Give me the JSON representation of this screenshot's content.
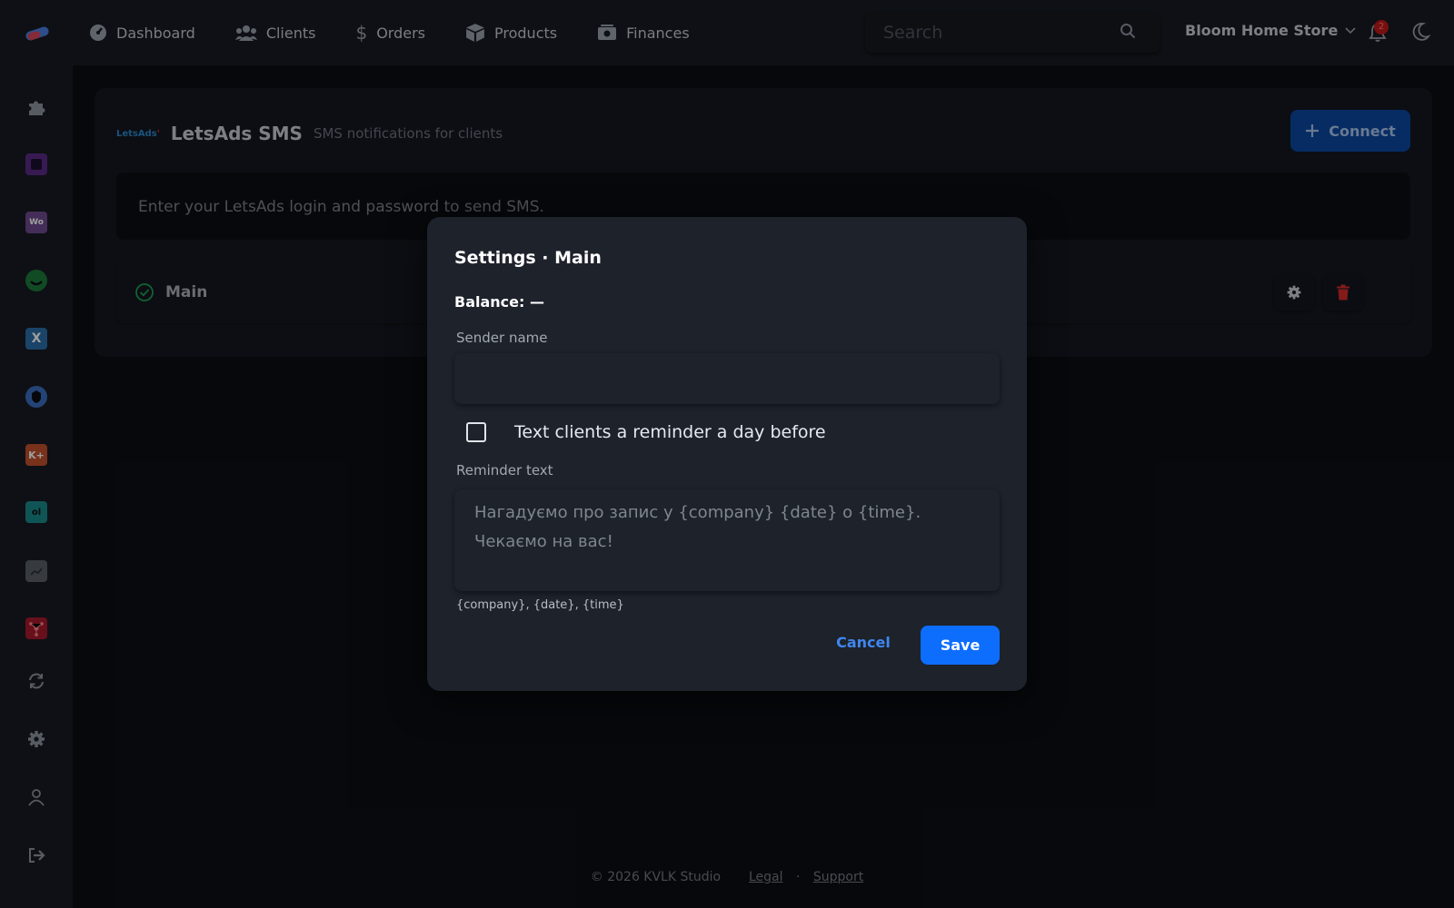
{
  "topbar": {
    "nav": [
      {
        "label": "Dashboard",
        "icon": "dashboard-icon"
      },
      {
        "label": "Clients",
        "icon": "users-icon"
      },
      {
        "label": "Orders",
        "icon": "dollar-icon"
      },
      {
        "label": "Products",
        "icon": "box-icon"
      },
      {
        "label": "Finances",
        "icon": "money-icon"
      }
    ],
    "search_placeholder": "Search",
    "store_name": "Bloom Home Store",
    "notification_count": "2"
  },
  "sidebar": {
    "items": [
      {
        "icon": "puzzle-icon"
      },
      {
        "icon": "square-app-icon",
        "color": "#5b2a86"
      },
      {
        "icon": "woo-icon",
        "label": "Wo",
        "color": "#6f4a8f"
      },
      {
        "icon": "green-smile-icon",
        "color": "#1c7a3a"
      },
      {
        "icon": "x-app-icon",
        "label": "X",
        "color": "#2a6ea8"
      },
      {
        "icon": "shield-app-icon",
        "color": "#3a6fbf"
      },
      {
        "icon": "k-app-icon",
        "label": "K+",
        "color": "#c2502a"
      },
      {
        "icon": "ol-app-icon",
        "label": "ol",
        "color": "#1b8a8a"
      },
      {
        "icon": "chart-app-icon",
        "color": "#5a6066"
      },
      {
        "icon": "network-app-icon",
        "color": "#a8192e"
      },
      {
        "icon": "sync-icon"
      },
      {
        "icon": "gear-icon"
      },
      {
        "icon": "user-icon"
      },
      {
        "icon": "logout-icon"
      }
    ]
  },
  "card": {
    "logo_text_a": "LetsAds",
    "title": "LetsAds SMS",
    "subtitle": "SMS notifications for clients",
    "connect_label": "Connect",
    "info": "Enter your LetsAds login and password to send SMS.",
    "account_name": "Main"
  },
  "modal": {
    "title": "Settings · Main",
    "balance": "Balance: —",
    "sender_label": "Sender name",
    "sender_value": "",
    "reminder_checkbox_label": "Text clients a reminder a day before",
    "reminder_checked": false,
    "reminder_label": "Reminder text",
    "reminder_line1": "Нагадуємо про запис у {company} {date} о {time}.",
    "reminder_line2": "Чекаємо на вас!",
    "variables_hint": "{company}, {date}, {time}",
    "cancel_label": "Cancel",
    "save_label": "Save"
  },
  "footer": {
    "copyright": "© 2026 KVLK Studio",
    "legal": "Legal",
    "separator": "·",
    "support": "Support"
  },
  "colors": {
    "accent": "#0d6efd",
    "success": "#1f9d55",
    "danger": "#c01919"
  }
}
